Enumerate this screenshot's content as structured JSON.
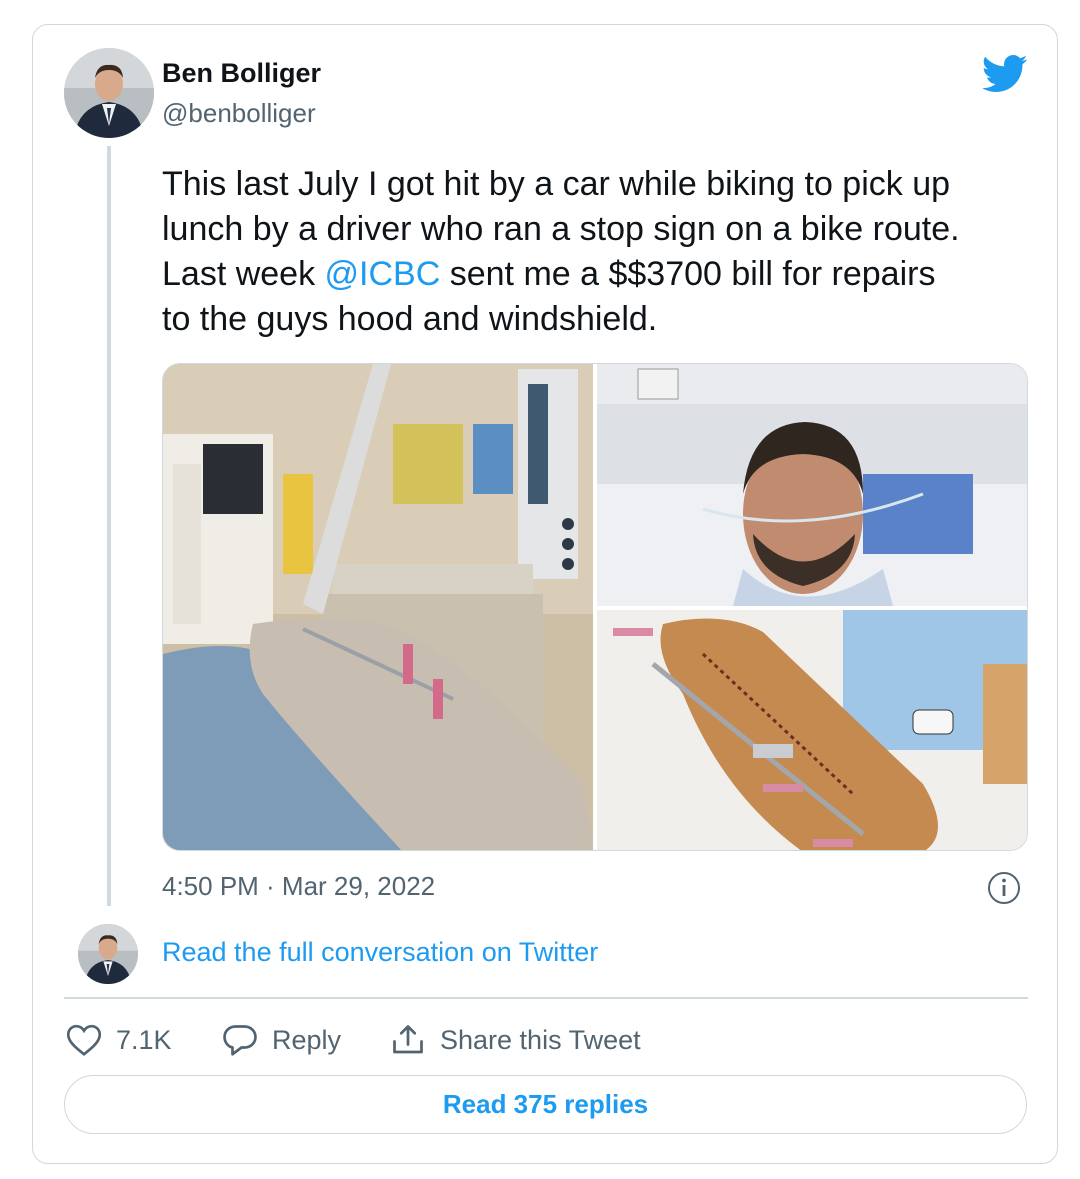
{
  "author": {
    "name": "Ben Bolliger",
    "handle": "@benbolliger"
  },
  "tweet": {
    "text_before": "This last July I got hit by a car while biking to pick up\nlunch by a driver who ran a stop sign on a bike route.\nLast week ",
    "mention": "@ICBC",
    "text_after": " sent me a $$3700 bill for repairs\nto the guys hood and windshield.",
    "timestamp": "4:50 PM · Mar 29, 2022"
  },
  "media": [
    {
      "icon": "photo-hospital-room-leg"
    },
    {
      "icon": "photo-hospital-selfie"
    },
    {
      "icon": "photo-stitched-leg"
    }
  ],
  "conversation_link": "Read the full conversation on Twitter",
  "actions": {
    "like_count": "7.1K",
    "reply_label": "Reply",
    "share_label": "Share this Tweet"
  },
  "read_replies_label": "Read 375 replies",
  "colors": {
    "accent": "#1d9bf0",
    "text": "#0f1419",
    "muted": "#536471",
    "border": "#cfd9de"
  }
}
